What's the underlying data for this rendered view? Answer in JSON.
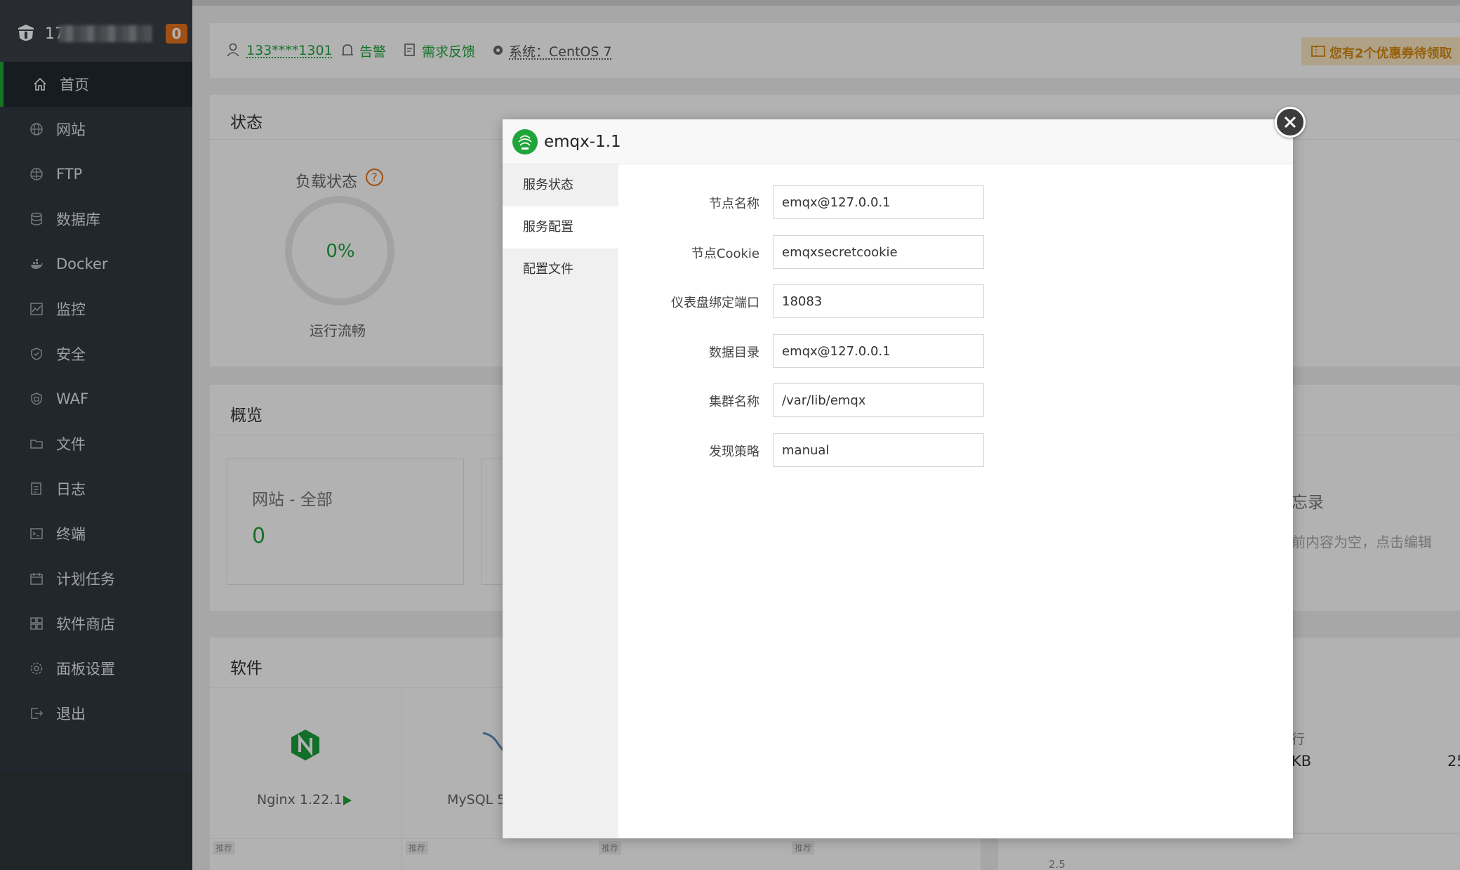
{
  "sidebar": {
    "user_visible": "17",
    "badge": "0",
    "items": [
      {
        "label": "首页",
        "icon": "home-icon"
      },
      {
        "label": "网站",
        "icon": "globe-icon"
      },
      {
        "label": "FTP",
        "icon": "ftp-icon"
      },
      {
        "label": "数据库",
        "icon": "database-icon"
      },
      {
        "label": "Docker",
        "icon": "docker-icon"
      },
      {
        "label": "监控",
        "icon": "monitor-icon"
      },
      {
        "label": "安全",
        "icon": "shield-icon"
      },
      {
        "label": "WAF",
        "icon": "waf-icon"
      },
      {
        "label": "文件",
        "icon": "folder-icon"
      },
      {
        "label": "日志",
        "icon": "log-icon"
      },
      {
        "label": "终端",
        "icon": "terminal-icon"
      },
      {
        "label": "计划任务",
        "icon": "calendar-icon"
      },
      {
        "label": "软件商店",
        "icon": "apps-icon"
      },
      {
        "label": "面板设置",
        "icon": "gear-icon"
      },
      {
        "label": "退出",
        "icon": "logout-icon"
      }
    ]
  },
  "header": {
    "user": "133****1301",
    "alarm": "告警",
    "feedback": "需求反馈",
    "system": "系统：CentOS 7",
    "coupon": "您有2个优惠券待领取"
  },
  "status_card": {
    "title": "状态",
    "load_label": "负载状态",
    "help": "?",
    "percent": "0%",
    "load_value": 0,
    "load_desc": "运行流畅"
  },
  "overview_card": {
    "title": "概览",
    "site_label": "网站 - 全部",
    "site_count": "0",
    "memo_partial": "忘录",
    "memo_hint_partial": "前内容为空，点击编辑"
  },
  "software_card": {
    "title": "软件",
    "nginx": "Nginx 1.22.1",
    "mysql": "MySQL 5.",
    "recommend": [
      "推荐",
      "推荐",
      "推荐",
      "推荐"
    ]
  },
  "right_partial": {
    "row_label": "行",
    "size": "KB",
    "num": "25",
    "axis": "2.5"
  },
  "modal": {
    "title": "emqx-1.1",
    "tabs": [
      "服务状态",
      "服务配置",
      "配置文件"
    ],
    "active_tab": 1,
    "fields": [
      {
        "label": "节点名称",
        "value": "emqx@127.0.0.1"
      },
      {
        "label": "节点Cookie",
        "value": "emqxsecretcookie"
      },
      {
        "label": "仪表盘绑定端口",
        "value": "18083"
      },
      {
        "label": "数据目录",
        "value": "emqx@127.0.0.1"
      },
      {
        "label": "集群名称",
        "value": "/var/lib/emqx"
      },
      {
        "label": "发现策略",
        "value": "manual"
      }
    ]
  },
  "colors": {
    "brand_green": "#20a53a",
    "badge_orange": "#e6731c",
    "sidebar_bg": "#303840"
  }
}
